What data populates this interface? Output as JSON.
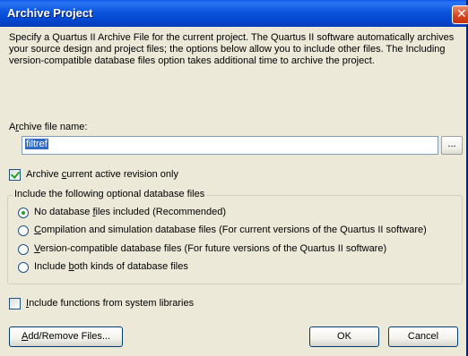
{
  "window": {
    "title": "Archive Project",
    "close_glyph": "✕"
  },
  "description": "Specify a Quartus II Archive File for the current project. The Quartus II software automatically archives your source design and project files; the options below allow you to include other files. The Including version-compatible database files option takes additional time to archive the project.",
  "archive_file": {
    "label_pre": "A",
    "label_ul": "r",
    "label_post": "chive file name:",
    "value": "filtref",
    "browse_label": "..."
  },
  "current_revision_only": {
    "checked": true,
    "label_pre": "Archive ",
    "label_ul": "c",
    "label_post": "urrent active revision only"
  },
  "database_group": {
    "title": "Include the following optional database files",
    "options": [
      {
        "pre": "No database ",
        "ul": "f",
        "post": "iles included  (Recommended)",
        "selected": true
      },
      {
        "pre": "",
        "ul": "C",
        "post": "ompilation and simulation database files (For current versions of the Quartus II software)",
        "selected": false
      },
      {
        "pre": "",
        "ul": "V",
        "post": "ersion-compatible database files (For future versions of the Quartus II software)",
        "selected": false
      },
      {
        "pre": "Include ",
        "ul": "b",
        "post": "oth kinds of database files",
        "selected": false
      }
    ]
  },
  "system_libraries": {
    "checked": false,
    "label_pre": "",
    "label_ul": "I",
    "label_post": "nclude functions from system libraries"
  },
  "buttons": {
    "add_remove_pre": "",
    "add_remove_ul": "A",
    "add_remove_post": "dd/Remove Files...",
    "ok": "OK",
    "cancel": "Cancel"
  },
  "colors": {
    "titlebar": "#0a58e8",
    "dialog_bg": "#ece9d8",
    "selection": "#316ac5",
    "check_mark": "#21a121"
  }
}
